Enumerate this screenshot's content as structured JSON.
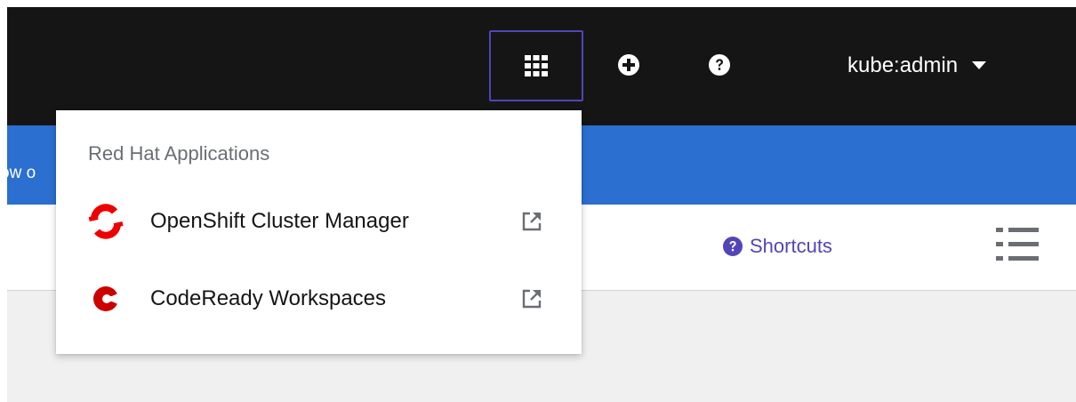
{
  "header": {
    "app_launcher_icon": "grid-icon",
    "quick_create_icon": "plus-circle-icon",
    "help_icon": "question-circle-icon",
    "user_menu_label": "kube:admin",
    "user_menu_icon": "caret-down-icon"
  },
  "banner": {
    "text": "ow o"
  },
  "toolbar": {
    "shortcuts_label": "Shortcuts",
    "shortcuts_icon": "question-circle-icon",
    "list_view_icon": "list-icon"
  },
  "dropdown": {
    "group_title": "Red Hat Applications",
    "items": [
      {
        "label": "OpenShift Cluster Manager",
        "icon": "openshift-logo-icon",
        "ext_icon": "external-link-icon"
      },
      {
        "label": "CodeReady Workspaces",
        "icon": "codeready-logo-icon",
        "ext_icon": "external-link-icon"
      }
    ]
  },
  "colors": {
    "masthead": "#151515",
    "banner": "#2b6fd0",
    "focus_outline": "#4f46b6",
    "link": "#5245b8",
    "brand_red": "#ee0000"
  }
}
